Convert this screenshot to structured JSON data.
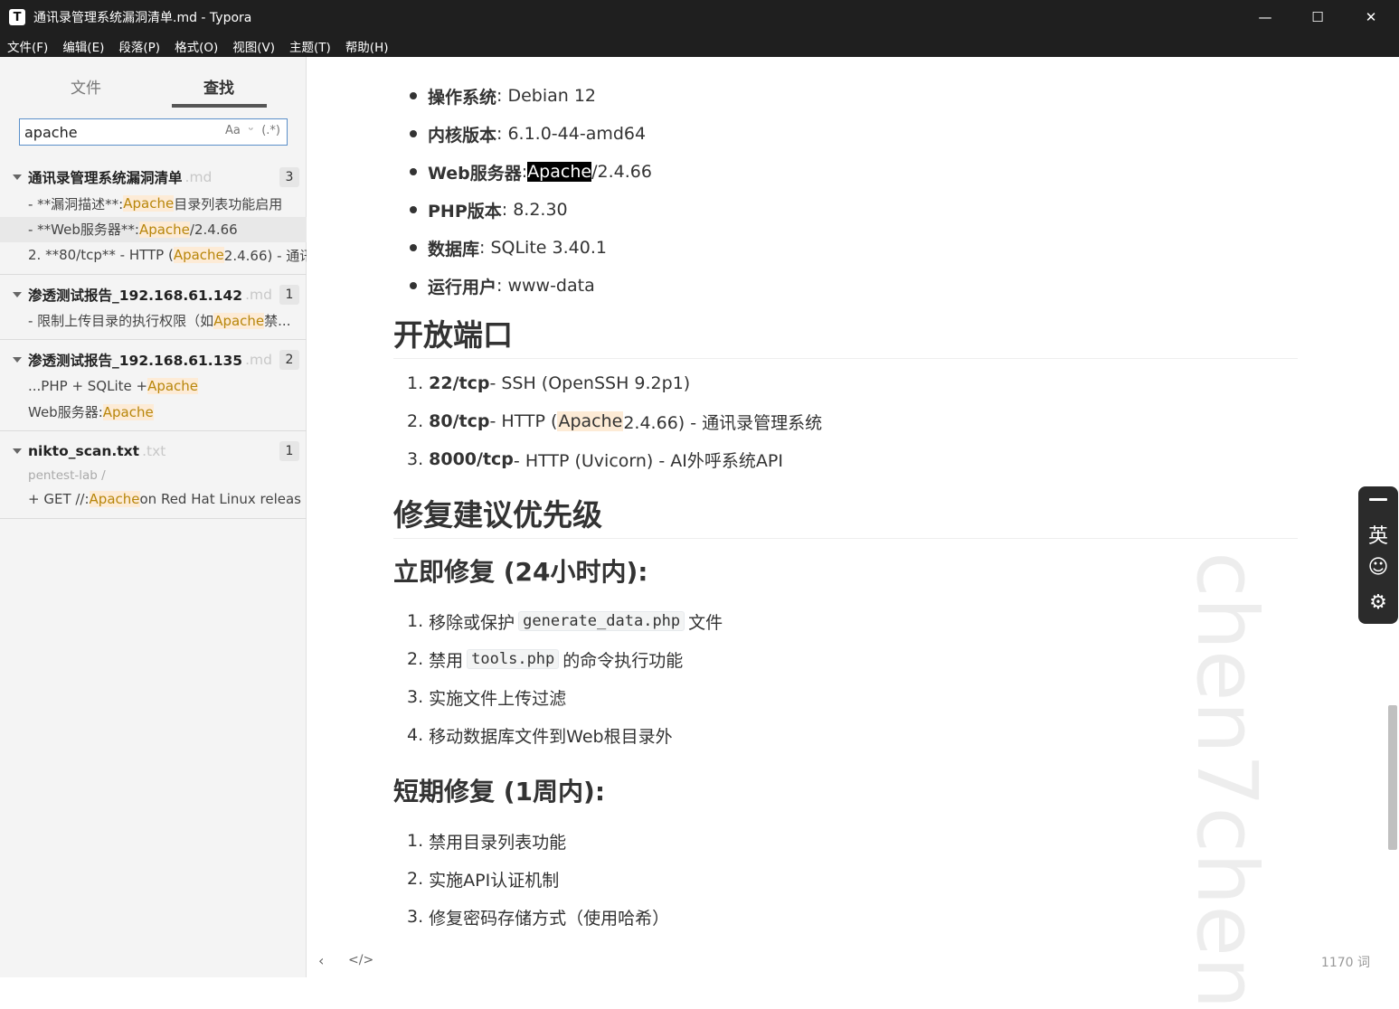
{
  "window": {
    "icon_letter": "T",
    "title": "通讯录管理系统漏洞清单.md - Typora",
    "minimize": "—",
    "maximize": "☐",
    "close": "✕"
  },
  "menubar": [
    "文件(F)",
    "编辑(E)",
    "段落(P)",
    "格式(O)",
    "视图(V)",
    "主题(T)",
    "帮助(H)"
  ],
  "sidebar": {
    "tabs": [
      "文件",
      "查找"
    ],
    "search": {
      "value": "apache",
      "opt_case": "Aa",
      "opt_word": "ᵕ",
      "opt_regex": "(.*)"
    },
    "groups": [
      {
        "name": "通讯录管理系统漏洞清单",
        "ext": ".md",
        "count": "3",
        "items": [
          {
            "pre": "- **漏洞描述**: ",
            "match": "Apache",
            "post": "目录列表功能启用"
          },
          {
            "pre": "- **Web服务器**: ",
            "match": "Apache",
            "post": "/2.4.66",
            "selected": true
          },
          {
            "pre": "2. **80/tcp** - HTTP (",
            "match": "Apache",
            "post": " 2.4.66) - 通讯"
          }
        ]
      },
      {
        "name": "渗透测试报告_192.168.61.142",
        "ext": ".md",
        "count": "1",
        "items": [
          {
            "pre": "- 限制上传目录的执行权限（如 ",
            "match": "Apache",
            "post": " 禁..."
          }
        ]
      },
      {
        "name": "渗透测试报告_192.168.61.135",
        "ext": ".md",
        "count": "2",
        "items": [
          {
            "pre": "...PHP + SQLite + ",
            "match": "Apache",
            "post": ""
          },
          {
            "pre": "Web服务器: ",
            "match": "Apache",
            "post": ""
          }
        ]
      },
      {
        "name": "nikto_scan.txt",
        "ext": ".txt",
        "count": "1",
        "path": "pentest-lab /",
        "items": [
          {
            "pre": "+ GET //: ",
            "match": "Apache",
            "post": " on Red Hat Linux releas"
          }
        ]
      }
    ]
  },
  "editor": {
    "env": [
      {
        "label": "操作系统",
        "value": ": Debian 12"
      },
      {
        "label": "内核版本",
        "value": ": 6.1.0-44-amd64"
      },
      {
        "label": "Web服务器",
        "value_pre": ": ",
        "selected": "Apache",
        "value_post": "/2.4.66"
      },
      {
        "label": "PHP版本",
        "value": ": 8.2.30"
      },
      {
        "label": "数据库",
        "value": ": SQLite 3.40.1"
      },
      {
        "label": "运行用户",
        "value": ": www-data"
      }
    ],
    "h_ports": "开放端口",
    "ports": [
      {
        "num": "1.",
        "port": "22/tcp",
        "desc": " - SSH (OpenSSH 9.2p1)"
      },
      {
        "num": "2.",
        "port": "80/tcp",
        "desc_pre": " - HTTP (",
        "match": "Apache",
        "desc_post": " 2.4.66) - 通讯录管理系统"
      },
      {
        "num": "3.",
        "port": "8000/tcp",
        "desc": " - HTTP (Uvicorn) - AI外呼系统API"
      }
    ],
    "h_priority": "修复建议优先级",
    "h_immediate": "立即修复 (24小时内):",
    "immediate": [
      {
        "num": "1.",
        "pre": "移除或保护",
        "code": "generate_data.php",
        "post": "文件"
      },
      {
        "num": "2.",
        "pre": "禁用",
        "code": "tools.php",
        "post": "的命令执行功能"
      },
      {
        "num": "3.",
        "text": "实施文件上传过滤"
      },
      {
        "num": "4.",
        "text": "移动数据库文件到Web根目录外"
      }
    ],
    "h_short": "短期修复 (1周内):",
    "short": [
      {
        "num": "1.",
        "text": "禁用目录列表功能"
      },
      {
        "num": "2.",
        "text": "实施API认证机制"
      },
      {
        "num": "3.",
        "text": "修复密码存储方式（使用哈希）"
      }
    ]
  },
  "watermark": "chen7chen",
  "ime": {
    "lang": "英",
    "emoji": "☺",
    "settings": "⚙"
  },
  "statusbar": {
    "back": "‹",
    "source": "</>",
    "word_count": "1170 词"
  }
}
